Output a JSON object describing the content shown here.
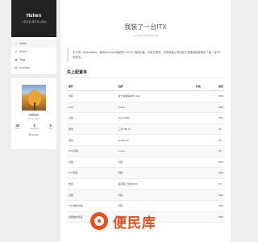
{
  "sidebar": {
    "brand_title": "Hshen",
    "brand_subtitle": "人若无名 便可专心练剑",
    "nav": [
      {
        "icon": "home-icon",
        "glyph": "⌂",
        "label": "Home"
      },
      {
        "icon": "user-icon",
        "glyph": "●",
        "label": "About"
      },
      {
        "icon": "tag-icon",
        "glyph": "◆",
        "label": "Tags"
      },
      {
        "icon": "archive-icon",
        "glyph": "▤",
        "label": "Archives"
      }
    ],
    "profile": {
      "name": "Hshen",
      "desc": "Hshen Blog",
      "stats": [
        {
          "num": "43",
          "label": "posts"
        },
        {
          "num": "3",
          "label": "categories"
        },
        {
          "num": "5",
          "label": "tags"
        }
      ],
      "github": "✪ GitHub"
    }
  },
  "post": {
    "title": "我装了一台ITX",
    "meta": "◷ Posted on 2022-11-23",
    "quote": "手头有一台MacBook，使用Windows场景很少/WTG+雷电U盘。也挺方便的，但是硬盘从事情益于机箱便使我萌生了装一台ITX的想法。",
    "section_title": "先上配置单",
    "table": {
      "headers": [
        "硬件",
        "品牌",
        "价格",
        "渠道"
      ],
      "rows": [
        [
          "内存",
          "金士顿骇客神条 16x2",
          "",
          "PDD"
        ],
        [
          "CPU",
          "12400",
          "",
          "PDD"
        ],
        [
          "主板",
          "Asus b660i",
          "",
          "PDD"
        ],
        [
          "硬盘",
          "三星 980 1T",
          "",
          "JD"
        ],
        [
          "散热",
          "Aeg90 full",
          "",
          "TB"
        ],
        [
          "CPU风扇",
          "Lonod",
          "",
          "TB"
        ],
        [
          "机箱",
          "利民",
          "",
          "PDD"
        ],
        [
          "17G风扇",
          "利民",
          "",
          "PDD"
        ],
        [
          "电源",
          "振南器 日金SF600",
          "",
          "TB"
        ],
        [
          "扫器",
          "利民",
          "",
          "PDD"
        ],
        [
          "CPU散热风扇",
          "利民",
          "",
          "PDD"
        ],
        [
          "机箱散热风扇",
          "振兴单元",
          "",
          "PDD"
        ]
      ]
    }
  },
  "watermark": {
    "text": "便民库"
  }
}
